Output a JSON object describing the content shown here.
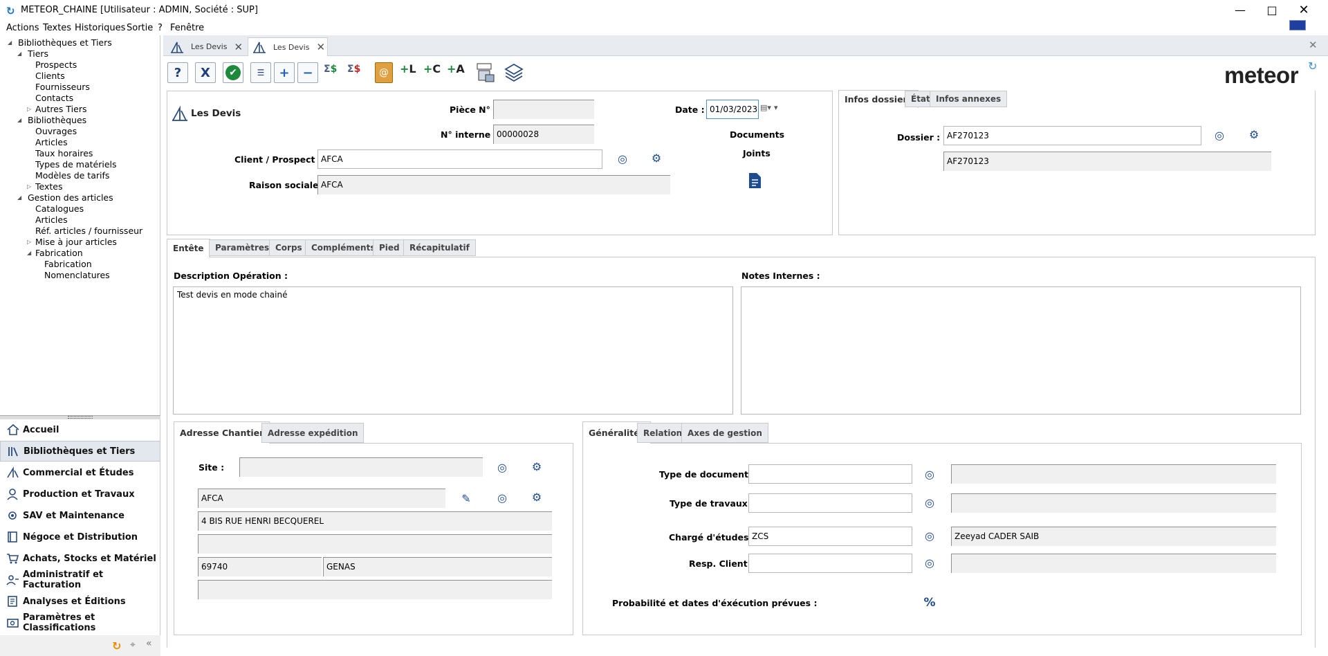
{
  "window": {
    "title": "METEOR_CHAINE [Utilisateur : ADMIN, Société : SUP]"
  },
  "menu": [
    "Actions",
    "Textes",
    "Historiques",
    "Sortie",
    "?",
    "Fenêtre"
  ],
  "tree": {
    "root": "Bibliothèques et Tiers",
    "tiers": "Tiers",
    "prospects": "Prospects",
    "clients": "Clients",
    "fournisseurs": "Fournisseurs",
    "contacts": "Contacts",
    "autres_tiers": "Autres Tiers",
    "bibliotheques": "Bibliothèques",
    "ouvrages": "Ouvrages",
    "articles": "Articles",
    "taux_horaires": "Taux horaires",
    "types_materiels": "Types de matériels",
    "modeles_tarifs": "Modèles de tarifs",
    "textes": "Textes",
    "gestion_articles": "Gestion des articles",
    "catalogues": "Catalogues",
    "articles2": "Articles",
    "ref_articles": "Réf. articles / fournisseur",
    "maj_articles": "Mise à jour articles",
    "fabrication": "Fabrication",
    "fabrication2": "Fabrication",
    "nomenclatures": "Nomenclatures"
  },
  "nav": [
    "Accueil",
    "Bibliothèques et Tiers",
    "Commercial et Études",
    "Production et Travaux",
    "SAV et Maintenance",
    "Négoce et Distribution",
    "Achats, Stocks et Matériel",
    "Administratif et Facturation",
    "Analyses et Éditions",
    "Paramètres et Classifications"
  ],
  "doc_tabs": [
    "Les Devis",
    "Les Devis"
  ],
  "toolbar": {
    "help": "?",
    "cancel": "X",
    "validate": "✔",
    "add": "+",
    "remove": "−"
  },
  "logo": "meteor",
  "header": {
    "form_title": "Les Devis",
    "piece_label": "Pièce N° :",
    "piece_value": "",
    "interne_label": "N° interne :",
    "interne_value": "00000028",
    "date_label": "Date :",
    "date_value": "01/03/2023",
    "client_label": "Client / Prospect :",
    "client_value": "AFCA",
    "raison_label": "Raison sociale :",
    "raison_value": "AFCA",
    "docs_label_1": "Documents",
    "docs_label_2": "Joints"
  },
  "dossier_tabs": [
    "Infos dossiers",
    "État",
    "Infos annexes"
  ],
  "dossier": {
    "label": "Dossier :",
    "value": "AF270123",
    "desc": "AF270123"
  },
  "main_tabs": [
    "Entête",
    "Paramètres",
    "Corps",
    "Compléments",
    "Pied",
    "Récapitulatif"
  ],
  "entete": {
    "desc_label": "Description Opération :",
    "desc_value": "Test devis en mode chainé",
    "notes_label": "Notes Internes :",
    "notes_value": ""
  },
  "address_tabs": [
    "Adresse Chantier",
    "Adresse expédition"
  ],
  "address": {
    "site_label": "Site :",
    "site_value": "",
    "name": "AFCA",
    "line1": "4 BIS RUE HENRI BECQUEREL",
    "line2": "",
    "zip": "69740",
    "city": "GENAS",
    "line3": ""
  },
  "gen_tabs": [
    "Généralités",
    "Relations",
    "Axes de gestion"
  ],
  "generalites": {
    "type_doc_label": "Type de document :",
    "type_doc_value": "",
    "type_doc_desc": "",
    "type_trav_label": "Type de travaux :",
    "type_trav_value": "",
    "type_trav_desc": "",
    "charge_label": "Chargé d'études :",
    "charge_value": "ZCS",
    "charge_desc": "Zeeyad CADER SAIB",
    "resp_label": "Resp. Client :",
    "resp_value": "",
    "resp_desc": "",
    "proba_label": "Probabilité et dates d'éxécution prévues :"
  },
  "icons": {
    "app": "app-logo-icon",
    "lookup": "target-lookup-icon",
    "settings": "gear-icon",
    "document": "document-icon",
    "edit": "edit-icon",
    "percent": "percent-icon"
  }
}
